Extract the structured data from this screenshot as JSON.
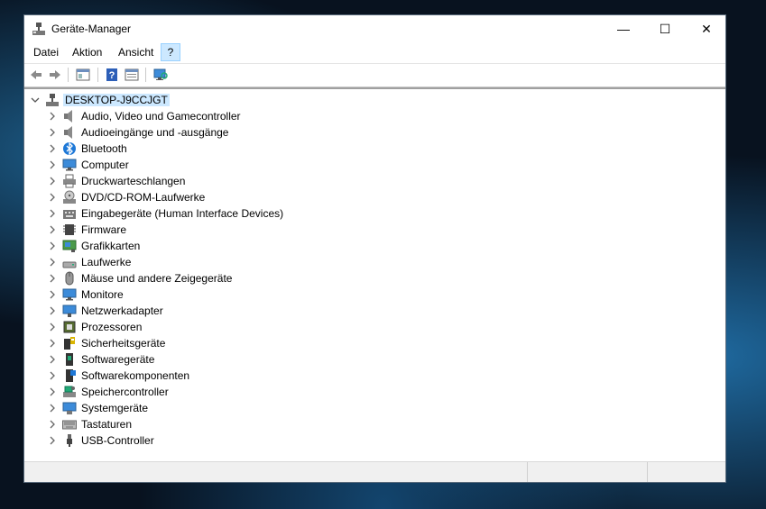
{
  "window": {
    "title": "Geräte-Manager",
    "controls": {
      "minimize": "—",
      "maximize": "☐",
      "close": "✕"
    }
  },
  "menu": {
    "items": [
      {
        "label": "Datei"
      },
      {
        "label": "Aktion"
      },
      {
        "label": "Ansicht"
      },
      {
        "label": "?"
      }
    ]
  },
  "toolbar": {
    "buttons": [
      "back-icon",
      "forward-icon",
      "show-hide-console-tree-icon",
      "help-icon",
      "properties-icon",
      "scan-hardware-icon"
    ]
  },
  "tree": {
    "root": {
      "label": "DESKTOP-J9CCJGT",
      "icon": "computer-icon"
    },
    "categories": [
      {
        "label": "Audio, Video und Gamecontroller",
        "icon": "speaker-icon"
      },
      {
        "label": "Audioeingänge und -ausgänge",
        "icon": "speaker-icon"
      },
      {
        "label": "Bluetooth",
        "icon": "bluetooth-icon"
      },
      {
        "label": "Computer",
        "icon": "monitor-icon"
      },
      {
        "label": "Druckwarteschlangen",
        "icon": "printer-icon"
      },
      {
        "label": "DVD/CD-ROM-Laufwerke",
        "icon": "disc-drive-icon"
      },
      {
        "label": "Eingabegeräte (Human Interface Devices)",
        "icon": "hid-icon"
      },
      {
        "label": "Firmware",
        "icon": "chip-icon"
      },
      {
        "label": "Grafikkarten",
        "icon": "display-adapter-icon"
      },
      {
        "label": "Laufwerke",
        "icon": "disk-drive-icon"
      },
      {
        "label": "Mäuse und andere Zeigegeräte",
        "icon": "mouse-icon"
      },
      {
        "label": "Monitore",
        "icon": "monitor-icon"
      },
      {
        "label": "Netzwerkadapter",
        "icon": "network-adapter-icon"
      },
      {
        "label": "Prozessoren",
        "icon": "processor-icon"
      },
      {
        "label": "Sicherheitsgeräte",
        "icon": "security-device-icon"
      },
      {
        "label": "Softwaregeräte",
        "icon": "software-device-icon"
      },
      {
        "label": "Softwarekomponenten",
        "icon": "software-component-icon"
      },
      {
        "label": "Speichercontroller",
        "icon": "storage-controller-icon"
      },
      {
        "label": "Systemgeräte",
        "icon": "system-device-icon"
      },
      {
        "label": "Tastaturen",
        "icon": "keyboard-icon"
      },
      {
        "label": "USB-Controller",
        "icon": "usb-icon"
      }
    ]
  },
  "colors": {
    "selection": "#cce8ff",
    "selection_border": "#99d1ff",
    "accent_blue": "#1e78d7"
  }
}
